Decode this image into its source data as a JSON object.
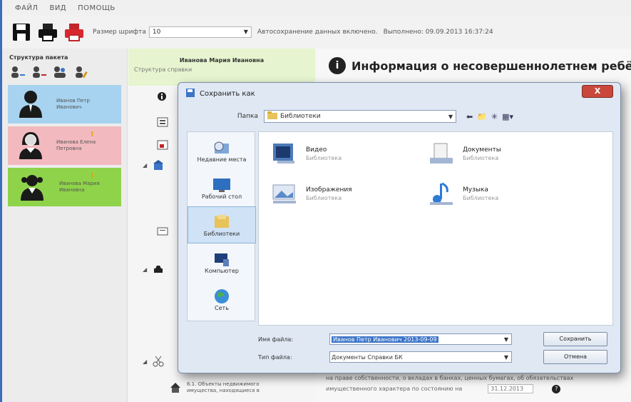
{
  "menu": [
    "ФАЙЛ",
    "ВИД",
    "ПОМОЩЬ"
  ],
  "toolbar": {
    "font_label": "Размер шрифта",
    "font_value": "10",
    "autosave": "Автосохранение данных включено.",
    "done": "Выполнено: 09.09.2013 16:37:24"
  },
  "left_panel": {
    "title": "Структура пакета",
    "persons": [
      {
        "name": "Иванов Петр Иванович",
        "color": "#a7d3f0",
        "warn": false
      },
      {
        "name": "Иванова Елена Петровна",
        "color": "#f2b9bf",
        "warn": true
      },
      {
        "name": "Иванова Мария Ивановна",
        "color": "#8fd34a",
        "warn": true
      }
    ]
  },
  "middle_panel": {
    "header": "Иванова Мария Ивановна",
    "subheader": "Структура справки",
    "bottom_item": "6.1. Объекты недвижимого имущества, находящиеся в"
  },
  "right_panel": {
    "title": "Информация о несовершеннолетнем ребёнке",
    "bottom_line1": "на праве собственности, о вкладах в банках, ценных бумагах, об обязательствах",
    "bottom_line2": "имущественного характера по состоянию на",
    "date": "31.12.2013"
  },
  "dialog": {
    "title": "Сохранить как",
    "close": "X",
    "folder_label": "Папка",
    "folder_value": "Библиотеки",
    "places": [
      "Недавние места",
      "Рабочий стол",
      "Библиотеки",
      "Компьютер",
      "Сеть"
    ],
    "libraries": [
      {
        "name": "Видео",
        "sub": "Библиотека"
      },
      {
        "name": "Документы",
        "sub": "Библиотека"
      },
      {
        "name": "Изображения",
        "sub": "Библиотека"
      },
      {
        "name": "Музыка",
        "sub": "Библиотека"
      }
    ],
    "filename_label": "Имя файла:",
    "filename_value": "Иванов Петр Иванович 2013-09-09",
    "filetype_label": "Тип файла:",
    "filetype_value": "Документы Справки БК",
    "save": "Сохранить",
    "cancel": "Отмена"
  }
}
